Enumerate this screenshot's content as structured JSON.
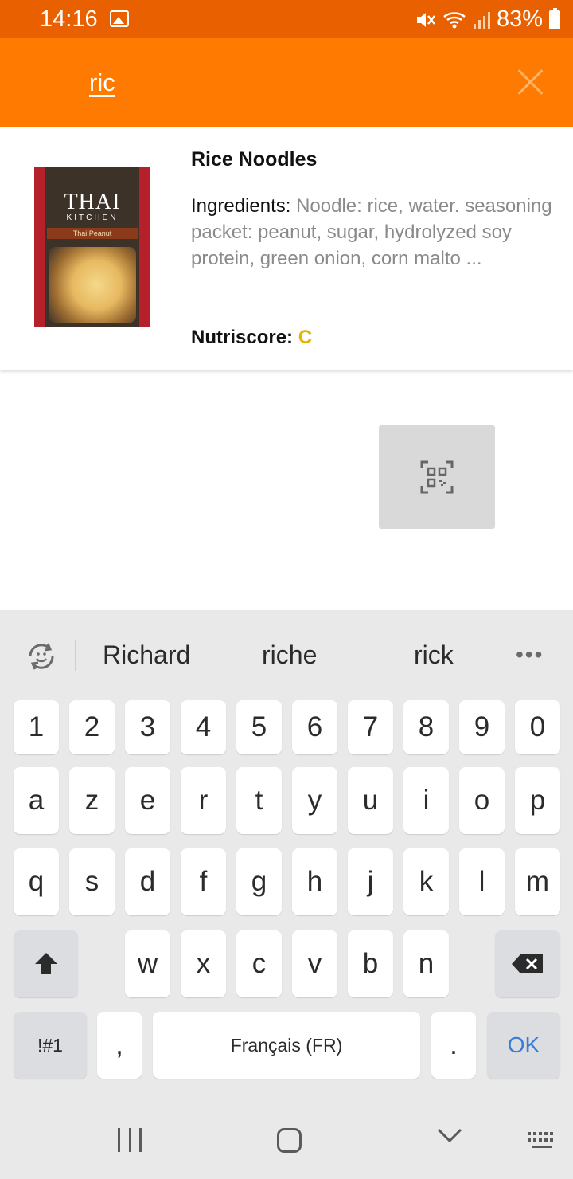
{
  "status_bar": {
    "time": "14:16",
    "battery": "83%",
    "icons": [
      "gallery-icon",
      "mute-icon",
      "wifi-icon",
      "signal-icon",
      "battery-icon"
    ]
  },
  "search": {
    "query": "ric"
  },
  "result": {
    "name": "Rice Noodles",
    "ingredients_label": "Ingredients: ",
    "ingredients_text": "Noodle: rice, water. seasoning packet: peanut, sugar, hydrolyzed soy protein, green onion, corn malto ...",
    "nutriscore_label": "Nutriscore: ",
    "nutriscore_value": "C",
    "image": {
      "brand": "THAI",
      "sub": "KITCHEN",
      "flavor": "Thai Peanut"
    }
  },
  "keyboard": {
    "suggestions": [
      "Richard",
      "riche",
      "rick"
    ],
    "row_numbers": [
      "1",
      "2",
      "3",
      "4",
      "5",
      "6",
      "7",
      "8",
      "9",
      "0"
    ],
    "row_1": [
      "a",
      "z",
      "e",
      "r",
      "t",
      "y",
      "u",
      "i",
      "o",
      "p"
    ],
    "row_2": [
      "q",
      "s",
      "d",
      "f",
      "g",
      "h",
      "j",
      "k",
      "l",
      "m"
    ],
    "row_3": [
      "w",
      "x",
      "c",
      "v",
      "b",
      "n"
    ],
    "symbols_label": "!#1",
    "comma_label": ",",
    "space_label": "Français (FR)",
    "period_label": ".",
    "ok_label": "OK"
  },
  "colors": {
    "status_bar": "#e86000",
    "header": "#ff7a00",
    "nutriscore_c": "#e8b400",
    "ok_key": "#3a7dd6"
  }
}
